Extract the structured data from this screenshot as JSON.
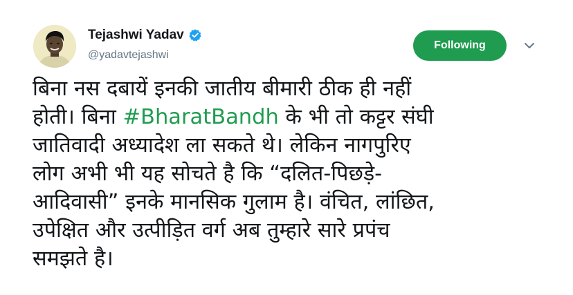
{
  "author": {
    "display_name": "Tejashwi Yadav",
    "handle": "@yadavtejashwi",
    "verified": true,
    "verified_badge_color": "#1da1f2"
  },
  "follow_button": {
    "label": "Following",
    "color": "#1f9c4f"
  },
  "menu": {
    "icon": "chevron-down-icon"
  },
  "tweet": {
    "line1": "बिना नस दबायें इनकी जातीय बीमारी ठीक ही नहीं",
    "line2_before": "होती। बिना ",
    "hashtag": "#BharatBandh",
    "line2_after": " के भी तो कट्टर संघी",
    "line3": "जातिवादी अध्यादेश ला सकते थे। लेकिन नागपुरिए",
    "line4": "लोग अभी भी यह सोचते है कि “दलित-पिछड़े-",
    "line5": "आदिवासी” इनके मानसिक गुलाम है। वंचित, लांछित,",
    "line6": "उपेक्षित और उत्पीड़ित वर्ग अब तुम्हारे सारे प्रपंच",
    "line7": "समझते है।",
    "hashtag_color": "#1f9c4f"
  }
}
